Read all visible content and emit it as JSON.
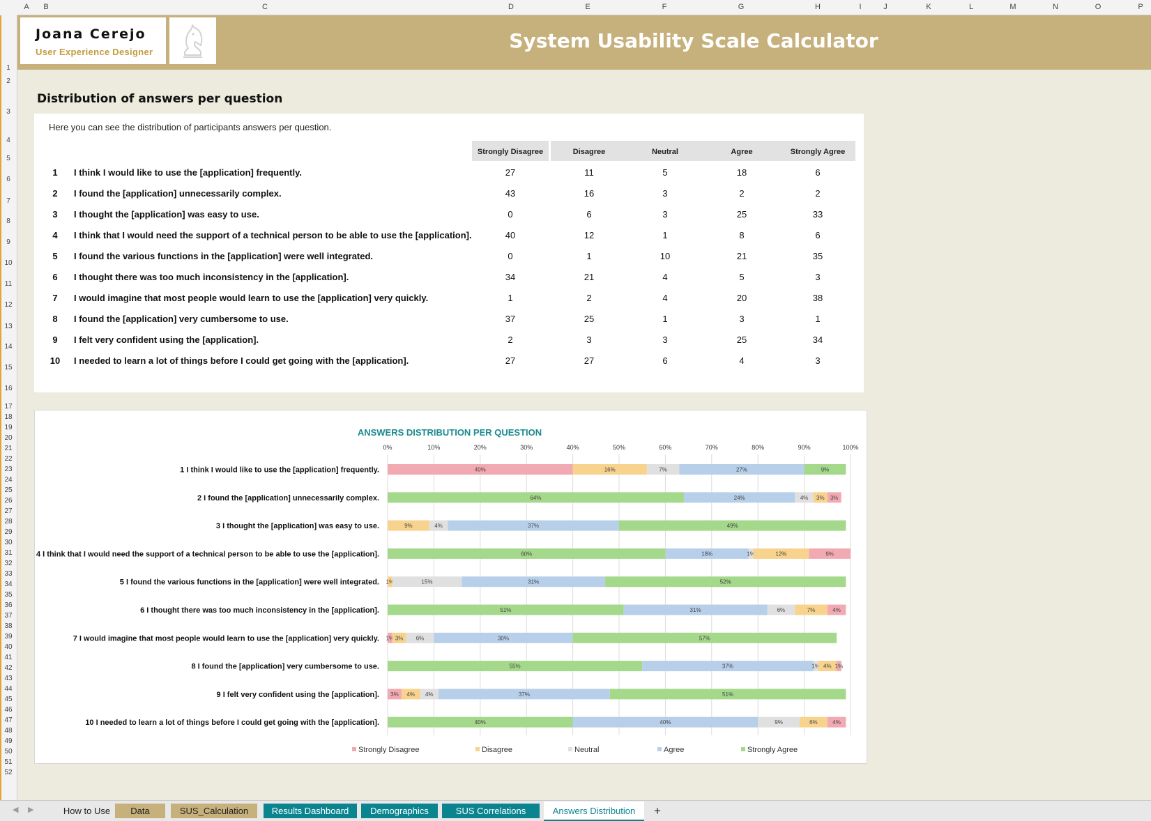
{
  "brand": {
    "name": "Joana Cerejo",
    "role": "User Experience Designer",
    "app_title": "System Usability Scale Calculator"
  },
  "grid": {
    "columns": [
      "A",
      "B",
      "C",
      "D",
      "E",
      "F",
      "G",
      "H",
      "I",
      "J",
      "K",
      "L",
      "M",
      "N",
      "O",
      "P"
    ],
    "rows": [
      "1",
      "2",
      "3",
      "4",
      "5",
      "6",
      "7",
      "8",
      "9",
      "10",
      "11",
      "12",
      "13",
      "14",
      "15",
      "16",
      "17",
      "18",
      "19",
      "20",
      "21",
      "22",
      "23",
      "24",
      "25",
      "26",
      "27",
      "28",
      "29",
      "30",
      "31",
      "32",
      "33",
      "34",
      "35",
      "36",
      "37",
      "38",
      "39",
      "40",
      "41",
      "42",
      "43",
      "44",
      "45",
      "46",
      "47",
      "48",
      "49",
      "50",
      "51",
      "52"
    ]
  },
  "section": {
    "title": "Distribution of answers per question",
    "intro": "Here you can see the distribution of participants answers per question."
  },
  "table": {
    "headers": [
      "Strongly Disagree",
      "Disagree",
      "Neutral",
      "Agree",
      "Strongly Agree"
    ],
    "rows": [
      {
        "num": "1",
        "text": "I think I would like to use the [application] frequently.",
        "values": [
          "27",
          "11",
          "5",
          "18",
          "6"
        ]
      },
      {
        "num": "2",
        "text": "I found the [application] unnecessarily complex.",
        "values": [
          "43",
          "16",
          "3",
          "2",
          "2"
        ]
      },
      {
        "num": "3",
        "text": "I thought the [application] was easy to use.",
        "values": [
          "0",
          "6",
          "3",
          "25",
          "33"
        ]
      },
      {
        "num": "4",
        "text": "I think that I would need the support of a technical person to be able to use the [application].",
        "values": [
          "40",
          "12",
          "1",
          "8",
          "6"
        ]
      },
      {
        "num": "5",
        "text": "I found the various functions in the [application] were well integrated.",
        "values": [
          "0",
          "1",
          "10",
          "21",
          "35"
        ]
      },
      {
        "num": "6",
        "text": "I thought there was too much inconsistency in the [application].",
        "values": [
          "34",
          "21",
          "4",
          "5",
          "3"
        ]
      },
      {
        "num": "7",
        "text": "I would imagine that most people would learn to use the [application] very quickly.",
        "values": [
          "1",
          "2",
          "4",
          "20",
          "38"
        ]
      },
      {
        "num": "8",
        "text": "I found the [application] very cumbersome to use.",
        "values": [
          "37",
          "25",
          "1",
          "3",
          "1"
        ]
      },
      {
        "num": "9",
        "text": "I felt very confident using the [application].",
        "values": [
          "2",
          "3",
          "3",
          "25",
          "34"
        ]
      },
      {
        "num": "10",
        "text": "I needed to learn a lot of things before I could get going with the [application].",
        "values": [
          "27",
          "27",
          "6",
          "4",
          "3"
        ]
      }
    ]
  },
  "chart_data": {
    "type": "bar",
    "orientation": "horizontal",
    "stacking": "percent",
    "title": "ANSWERS DISTRIBUTION PER QUESTION",
    "xlim": [
      0,
      100
    ],
    "xticks": [
      "0%",
      "10%",
      "20%",
      "30%",
      "40%",
      "50%",
      "60%",
      "70%",
      "80%",
      "90%",
      "100%"
    ],
    "grid": true,
    "legend_position": "bottom",
    "categories": [
      {
        "num": "1",
        "text": "I think I would like to use the [application] frequently."
      },
      {
        "num": "2",
        "text": "I found the [application] unnecessarily complex."
      },
      {
        "num": "3",
        "text": "I thought the [application] was easy to use."
      },
      {
        "num": "4",
        "text": "I think that I would need the support of a technical person to be able to use the [application]."
      },
      {
        "num": "5",
        "text": "I found the various functions in the [application] were well integrated."
      },
      {
        "num": "6",
        "text": "I thought there was too much inconsistency in the [application]."
      },
      {
        "num": "7",
        "text": "I would imagine that most people would learn to use the [application] very quickly."
      },
      {
        "num": "8",
        "text": "I found the [application] very cumbersome to use."
      },
      {
        "num": "9",
        "text": "I felt very confident using the [application]."
      },
      {
        "num": "10",
        "text": "I needed to learn a lot of things before I could get going with the [application]."
      }
    ],
    "series": [
      {
        "name": "Strongly Disagree",
        "color": "#f2aab2"
      },
      {
        "name": "Disagree",
        "color": "#f8d38d"
      },
      {
        "name": "Neutral",
        "color": "#e0e0e0"
      },
      {
        "name": "Agree",
        "color": "#b8cfea"
      },
      {
        "name": "Strongly Agree",
        "color": "#a4d88a"
      }
    ],
    "bars": [
      [
        {
          "s": 0,
          "v": 40,
          "label": "40%"
        },
        {
          "s": 1,
          "v": 16,
          "label": "16%"
        },
        {
          "s": 2,
          "v": 7,
          "label": "7%"
        },
        {
          "s": 3,
          "v": 27,
          "label": "27%"
        },
        {
          "s": 4,
          "v": 9,
          "label": "9%"
        }
      ],
      [
        {
          "s": 4,
          "v": 64,
          "label": "64%"
        },
        {
          "s": 3,
          "v": 24,
          "label": "24%"
        },
        {
          "s": 2,
          "v": 4,
          "label": "4%"
        },
        {
          "s": 1,
          "v": 3,
          "label": "3%"
        },
        {
          "s": 0,
          "v": 3,
          "label": "3%"
        }
      ],
      [
        {
          "s": 0,
          "v": 0,
          "label": "0%"
        },
        {
          "s": 1,
          "v": 9,
          "label": "9%"
        },
        {
          "s": 2,
          "v": 4,
          "label": "4%"
        },
        {
          "s": 3,
          "v": 37,
          "label": "37%"
        },
        {
          "s": 4,
          "v": 49,
          "label": "49%"
        }
      ],
      [
        {
          "s": 4,
          "v": 60,
          "label": "60%"
        },
        {
          "s": 3,
          "v": 18,
          "label": "18%"
        },
        {
          "s": 2,
          "v": 1,
          "label": "1%"
        },
        {
          "s": 1,
          "v": 12,
          "label": "12%"
        },
        {
          "s": 0,
          "v": 9,
          "label": "9%"
        }
      ],
      [
        {
          "s": 0,
          "v": 0,
          "label": "0%"
        },
        {
          "s": 1,
          "v": 1,
          "label": "1%"
        },
        {
          "s": 2,
          "v": 15,
          "label": "15%"
        },
        {
          "s": 3,
          "v": 31,
          "label": "31%"
        },
        {
          "s": 4,
          "v": 52,
          "label": "52%"
        }
      ],
      [
        {
          "s": 4,
          "v": 51,
          "label": "51%"
        },
        {
          "s": 3,
          "v": 31,
          "label": "31%"
        },
        {
          "s": 2,
          "v": 6,
          "label": "6%"
        },
        {
          "s": 1,
          "v": 7,
          "label": "7%"
        },
        {
          "s": 0,
          "v": 4,
          "label": "4%"
        }
      ],
      [
        {
          "s": 0,
          "v": 1,
          "label": "1%"
        },
        {
          "s": 1,
          "v": 3,
          "label": "3%"
        },
        {
          "s": 2,
          "v": 6,
          "label": "6%"
        },
        {
          "s": 3,
          "v": 30,
          "label": "30%"
        },
        {
          "s": 4,
          "v": 57,
          "label": "57%"
        }
      ],
      [
        {
          "s": 4,
          "v": 55,
          "label": "55%"
        },
        {
          "s": 3,
          "v": 37,
          "label": "37%"
        },
        {
          "s": 2,
          "v": 1,
          "label": "1%"
        },
        {
          "s": 1,
          "v": 4,
          "label": "4%"
        },
        {
          "s": 0,
          "v": 1,
          "label": "1%"
        }
      ],
      [
        {
          "s": 0,
          "v": 3,
          "label": "3%"
        },
        {
          "s": 1,
          "v": 4,
          "label": "4%"
        },
        {
          "s": 2,
          "v": 4,
          "label": "4%"
        },
        {
          "s": 3,
          "v": 37,
          "label": "37%"
        },
        {
          "s": 4,
          "v": 51,
          "label": "51%"
        }
      ],
      [
        {
          "s": 4,
          "v": 40,
          "label": "40%"
        },
        {
          "s": 3,
          "v": 40,
          "label": "40%"
        },
        {
          "s": 2,
          "v": 9,
          "label": "9%"
        },
        {
          "s": 1,
          "v": 6,
          "label": "6%"
        },
        {
          "s": 0,
          "v": 4,
          "label": "4%"
        }
      ]
    ]
  },
  "sheet_tabs": [
    {
      "label": "How to Use",
      "style": "plain"
    },
    {
      "label": "Data",
      "style": "gold"
    },
    {
      "label": "SUS_Calculation",
      "style": "gold"
    },
    {
      "label": "Results Dashboard",
      "style": "teal"
    },
    {
      "label": "Demographics",
      "style": "teal"
    },
    {
      "label": "SUS Correlations",
      "style": "teal"
    },
    {
      "label": "Answers Distribution",
      "style": "active"
    }
  ],
  "add_sheet_label": "+",
  "icons": {
    "prev": "nav-left-icon",
    "next": "nav-right-icon",
    "logo": "chess-knight-icon"
  },
  "colors": {
    "gold": "#c6b07b",
    "teal": "#0a8590",
    "chart_title": "#1a8a8f",
    "role_text": "#c49a3d",
    "sheet_bg": "#ecebde"
  }
}
